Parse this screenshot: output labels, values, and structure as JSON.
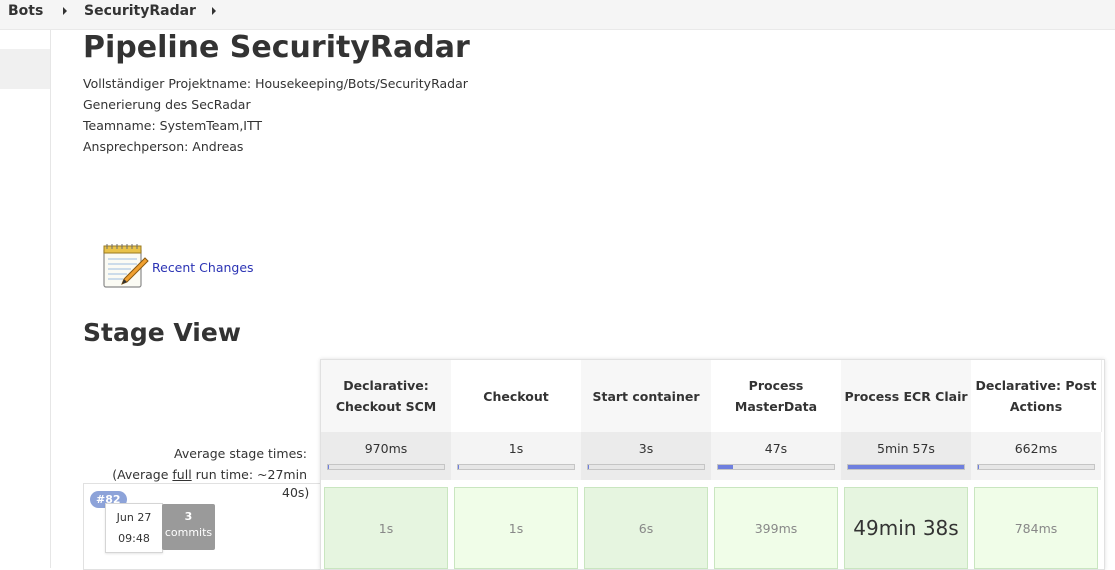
{
  "breadcrumb": [
    "Bots",
    "SecurityRadar"
  ],
  "page": {
    "title": "Pipeline SecurityRadar",
    "description": [
      "Vollständiger Projektname: Housekeeping/Bots/SecurityRadar",
      "Generierung des SecRadar",
      "Teamname: SystemTeam,ITT",
      "Ansprechperson: Andreas"
    ]
  },
  "recent_changes": {
    "label": "Recent Changes",
    "icon": "notepad-pencil-icon"
  },
  "stage_view": {
    "heading": "Stage View",
    "avg_label": "Average stage times:",
    "avg_full_prefix": "(Average ",
    "avg_full_word": "full",
    "avg_full_suffix": " run time: ~27min",
    "avg_full_tail": "40s)",
    "stages": [
      {
        "name": "Declarative: Checkout SCM",
        "avg": "970ms",
        "avg_fraction": 0.01,
        "run": "1s",
        "shade": "#e6f5e0"
      },
      {
        "name": "Checkout",
        "avg": "1s",
        "avg_fraction": 0.01,
        "run": "1s",
        "shade": "#f0fde8"
      },
      {
        "name": "Start container",
        "avg": "3s",
        "avg_fraction": 0.01,
        "run": "6s",
        "shade": "#e6f5e0"
      },
      {
        "name": "Process MasterData",
        "avg": "47s",
        "avg_fraction": 0.13,
        "run": "399ms",
        "shade": "#f0fde8"
      },
      {
        "name": "Process ECR Clair",
        "avg": "5min 57s",
        "avg_fraction": 1.0,
        "run": "49min 38s",
        "shade": "#e6f5e0"
      },
      {
        "name": "Declarative: Post Actions",
        "avg": "662ms",
        "avg_fraction": 0.01,
        "run": "784ms",
        "shade": "#f0fde8"
      }
    ],
    "build": {
      "number": "#82",
      "date": "Jun 27",
      "time": "09:48",
      "commit_count": "3",
      "commit_label": "commits"
    },
    "colors": {
      "progress": "#6f7fde",
      "header_alt": "#f5f5f5",
      "run_border": "#c9e6c0"
    }
  }
}
